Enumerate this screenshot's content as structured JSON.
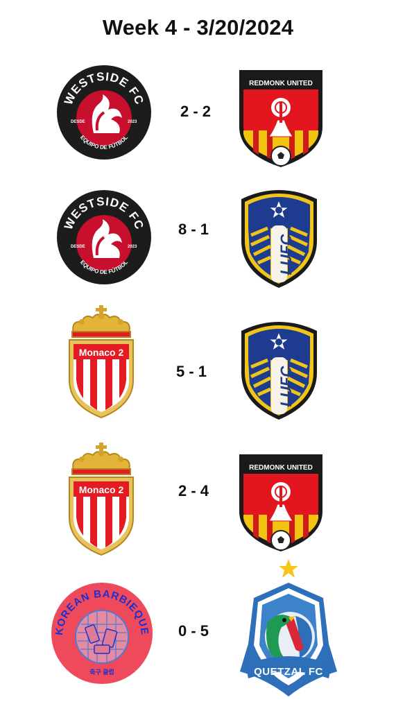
{
  "title": "Week 4 - 3/20/2024",
  "matches": [
    {
      "home": {
        "name": "WESTSIDE FC",
        "sub": "EQUIPO DE FÚTBOL",
        "left": "DESDE",
        "right": "2023"
      },
      "score": "2 - 2",
      "away": {
        "name": "REDMONK UNITED"
      }
    },
    {
      "home": {
        "name": "WESTSIDE FC",
        "sub": "EQUIPO DE FÚTBOL",
        "left": "DESDE",
        "right": "2023"
      },
      "score": "8 - 1",
      "away": {
        "name": "LUFC"
      }
    },
    {
      "home": {
        "name": "Monaco 2"
      },
      "score": "5 - 1",
      "away": {
        "name": "LUFC"
      }
    },
    {
      "home": {
        "name": "Monaco 2"
      },
      "score": "2 - 4",
      "away": {
        "name": "REDMONK UNITED"
      }
    },
    {
      "home": {
        "name": "KOREAN BARBIEQUE",
        "sub": "축구 클럽"
      },
      "score": "0 - 5",
      "away": {
        "name": "QUETZAL FC"
      }
    }
  ],
  "colors": {
    "westside_red": "#c8102e",
    "redmonk_red": "#e3151f",
    "leeds_blue": "#1d3c8f",
    "leeds_yellow": "#f0c419",
    "monaco_red": "#e41b23",
    "monaco_gold": "#d4a42a",
    "korean_pink": "#ef4a5b",
    "korean_blue": "#1e2fd0",
    "quetzal_blue": "#2d6fb8",
    "star": "#f5c518"
  }
}
